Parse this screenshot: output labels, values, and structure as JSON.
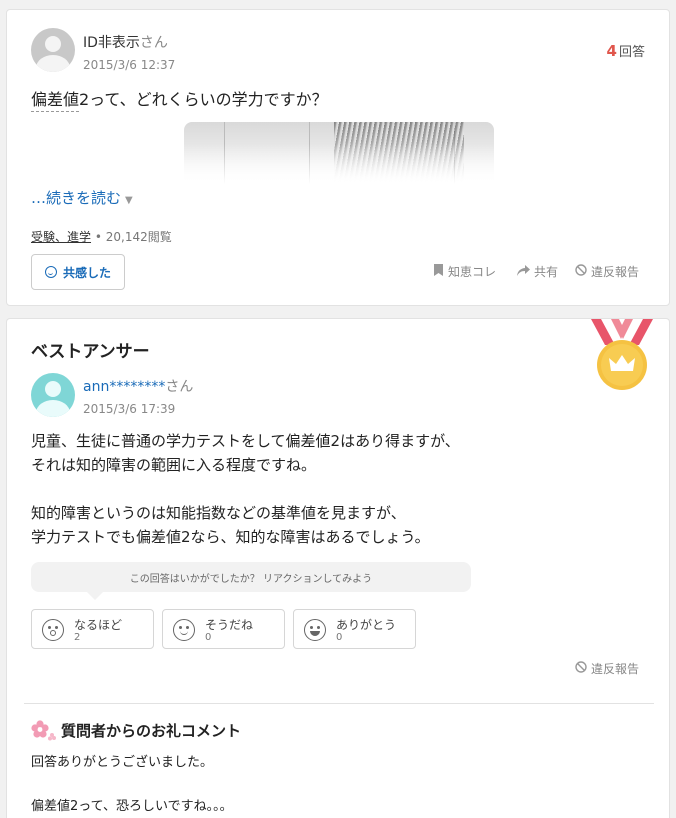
{
  "question": {
    "user_name": "ID非表示",
    "user_suffix": "さん",
    "date": "2015/3/6 12:37",
    "answer_count": "4",
    "answer_count_label": "回答",
    "title": "偏差値2って、どれくらいの学力ですか？",
    "read_more": "…続きを読む",
    "category_1": "受験、進学",
    "views": "20,142閲覧",
    "empathy_label": "共感した",
    "bookmark_label": "知恵コレ",
    "share_label": "共有",
    "report_label": "違反報告"
  },
  "best_answer": {
    "heading": "ベストアンサー",
    "user_name": "ann********",
    "user_suffix": "さん",
    "date": "2015/3/6 17:39",
    "paragraph_1": "児童、生徒に普通の学力テストをして偏差値2はあり得ますが、\nそれは知的障害の範囲に入る程度ですね。",
    "paragraph_2": "知的障害というのは知能指数などの基準値を見ますが、\n学力テストでも偏差値2なら、知的な障害はあるでしょう。",
    "reaction_prompt": "この回答はいかがでしたか？ リアクションしてみよう",
    "reactions": [
      {
        "label": "なるほど",
        "count": "2",
        "icon": "surprised-face-icon"
      },
      {
        "label": "そうだね",
        "count": "0",
        "icon": "smile-face-icon"
      },
      {
        "label": "ありがとう",
        "count": "0",
        "icon": "grin-face-icon"
      }
    ],
    "report_label": "違反報告"
  },
  "thanks": {
    "heading": "質問者からのお礼コメント",
    "line_1": "回答ありがとうございました。",
    "line_2": "偏差値2って、恐ろしいですね。。。"
  },
  "colors": {
    "link": "#1a6bb8",
    "count_accent": "#e0564c",
    "medal_gold": "#f5c242",
    "ribbon": "#e8556a",
    "answer_avatar": "#7fd6d6"
  }
}
